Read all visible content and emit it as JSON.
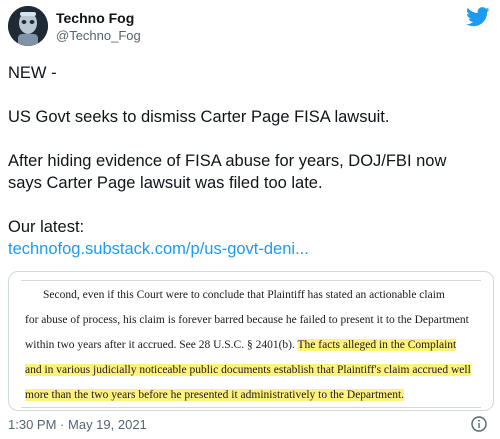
{
  "author": {
    "name": "Techno Fog",
    "handle": "@Techno_Fog"
  },
  "tweet": {
    "lines": [
      "NEW -",
      "US Govt seeks to dismiss Carter Page FISA lawsuit.",
      "After hiding evidence of FISA abuse for years, DOJ/FBI now",
      "says Carter Page lawsuit was filed too late.",
      "Our latest:"
    ],
    "link": "technofog.substack.com/p/us-govt-deni..."
  },
  "document": {
    "line1": "Second, even if this Court were to conclude that Plaintiff has stated an actionable claim",
    "line2": "for abuse of process, his claim is forever barred because he failed to present it to the Department",
    "line3_plain": "within two years after it accrued.  See 28 U.S.C. § 2401(b). ",
    "line3_highlight": "The facts alleged in the Complaint",
    "line4_highlight": "and in various judicially noticeable public documents establish that Plaintiff's claim accrued well",
    "line5_highlight": "more than the two years before he presented it administratively to the Department."
  },
  "footer": {
    "time": "1:30 PM",
    "separator": "·",
    "date": "May 19, 2021"
  },
  "colors": {
    "link": "#1d9bf0",
    "highlight": "#fff27a",
    "muted": "#536471"
  },
  "icons": {
    "brand": "twitter-bird-icon",
    "info": "info-icon"
  }
}
